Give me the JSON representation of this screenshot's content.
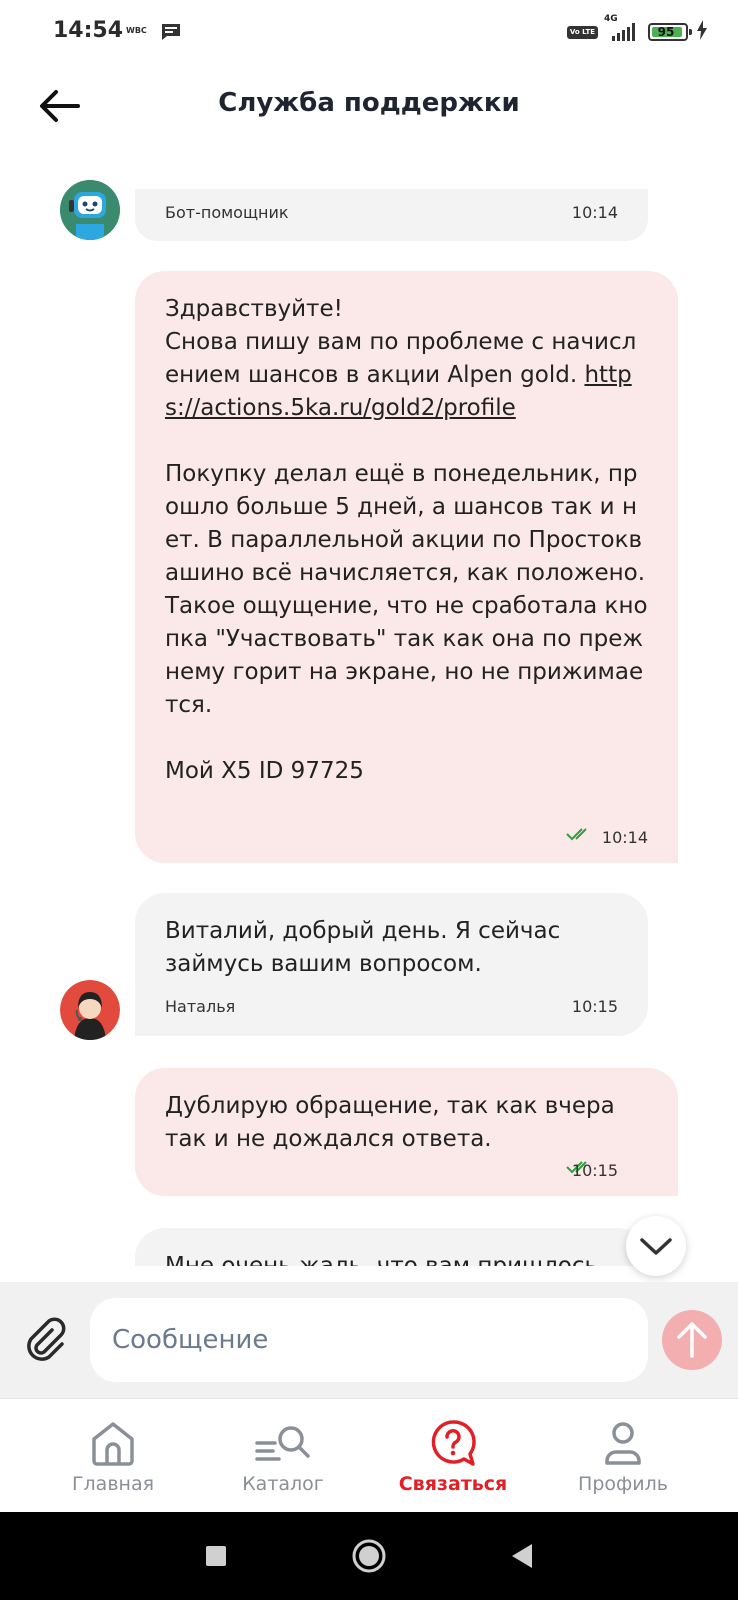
{
  "status_bar": {
    "time": "14:54",
    "carrier": "WBC",
    "network_label": "4G",
    "volte_label": "Vo LTE",
    "battery": "95"
  },
  "header": {
    "title": "Служба поддержки"
  },
  "messages": [
    {
      "sender": "Бот-помощник",
      "time": "10:14",
      "type": "incoming"
    },
    {
      "type": "outgoing",
      "text_before_link": "Здравствуйте!\nСнова пишу вам по проблеме с начислением шансов в акции Alpen gold. ",
      "link": "https://actions.5ka.ru/gold2/profile",
      "text_after_link": "\n\nПокупку делал ещё в понедельник, прошло больше 5 дней, а шансов так и нет. В параллельной акции по Простоквашино всё начисляется, как положено. Такое ощущение, что не сработала кнопка \"Участвовать\" так как она по прежнему горит на экране, но не прижимается.\n\nМой X5 ID 97725",
      "time": "10:14"
    },
    {
      "type": "incoming",
      "text": "Виталий, добрый день. Я сейчас займусь вашим вопросом.",
      "sender": "Наталья",
      "time": "10:15"
    },
    {
      "type": "outgoing",
      "text": "Дублирую обращение, так как вчера так и не дождался ответа.",
      "time": "10:15"
    },
    {
      "type": "incoming",
      "text": "Мне очень жаль, что вам пришлось"
    }
  ],
  "composer": {
    "placeholder": "Сообщение"
  },
  "nav": [
    {
      "label": "Главная",
      "icon": "home-icon"
    },
    {
      "label": "Каталог",
      "icon": "catalog-search-icon"
    },
    {
      "label": "Связаться",
      "icon": "help-chat-icon",
      "active": true
    },
    {
      "label": "Профиль",
      "icon": "profile-icon"
    }
  ],
  "colors": {
    "accent": "#e31e24",
    "outgoing_bubble": "#fbe8e8",
    "incoming_bubble": "#f3f3f3",
    "read_ticks": "#2e9e3e",
    "send_button": "#f3aeb0"
  }
}
